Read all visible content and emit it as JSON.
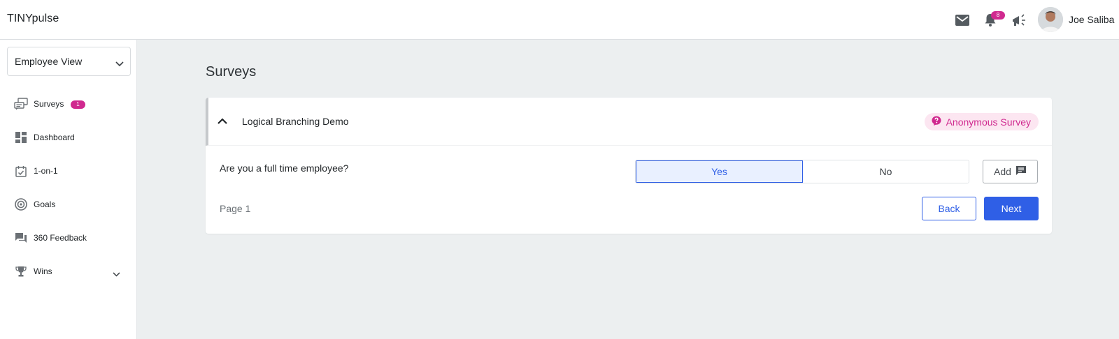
{
  "header": {
    "brand": "TINYpulse",
    "notification_count": "8",
    "user_name": "Joe Saliba",
    "icons": [
      "mail-icon",
      "bell-icon",
      "megaphone-icon",
      "avatar"
    ]
  },
  "sidebar": {
    "view_select": {
      "selected": "Employee View"
    },
    "items": [
      {
        "label": "Surveys",
        "icon": "surveys-icon",
        "badge": "1"
      },
      {
        "label": "Dashboard",
        "icon": "dashboard-icon"
      },
      {
        "label": "1-on-1",
        "icon": "calendar-check-icon"
      },
      {
        "label": "Goals",
        "icon": "target-icon"
      },
      {
        "label": "360 Feedback",
        "icon": "feedback-icon"
      },
      {
        "label": "Wins",
        "icon": "trophy-icon",
        "expandable": true
      }
    ]
  },
  "main": {
    "page_title": "Surveys",
    "survey": {
      "name": "Logical Branching Demo",
      "anonymous_label": "Anonymous Survey",
      "question": "Are you a full time employee?",
      "options": [
        "Yes",
        "No"
      ],
      "selected_option": "Yes",
      "add_comment_label": "Add",
      "page_label": "Page 1",
      "back_label": "Back",
      "next_label": "Next"
    }
  },
  "colors": {
    "accent": "#2f5fe6",
    "badge": "#d0298f",
    "anonymous_pill_bg": "#fce6f1",
    "page_bg": "#eceff0"
  }
}
